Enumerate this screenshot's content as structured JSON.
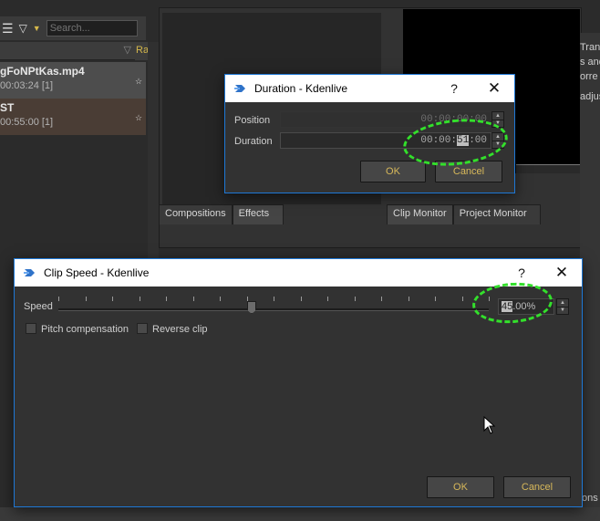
{
  "background": {
    "search_placeholder": "Search...",
    "column_header_r": "Ra",
    "clips": [
      {
        "name": "gFoNPtKas.mp4",
        "duration": "00:03:24 [1]"
      },
      {
        "name": "ST",
        "duration": "00:55:00 [1]"
      }
    ],
    "monitor_tabs_left": [
      "Compositions",
      "Effects"
    ],
    "monitor_tabs_right": [
      "Clip Monitor",
      "Project Monitor"
    ],
    "right_panel_lines": [
      "Trans",
      "s and",
      "orre",
      "adjus"
    ],
    "right_bottom_text": "ons"
  },
  "duration_dialog": {
    "title": "Duration - Kdenlive",
    "help": "?",
    "close": "✕",
    "position_label": "Position",
    "position_value": "00:00:00:00",
    "duration_label": "Duration",
    "duration_value_prefix": "00:00:",
    "duration_value_selected": "51",
    "duration_value_suffix": ":00",
    "ok_label": "OK",
    "cancel_label": "Cancel"
  },
  "speed_dialog": {
    "title": "Clip Speed - Kdenlive",
    "help": "?",
    "close": "✕",
    "speed_label": "Speed",
    "speed_selected": "45",
    "speed_suffix": ".00%",
    "slider_level_fraction": 0.45,
    "pitch_label": "Pitch compensation",
    "reverse_label": "Reverse clip",
    "ok_label": "OK",
    "cancel_label": "Cancel"
  },
  "colors": {
    "accent_button_text": "#d7b85a",
    "annotation": "#33e02b",
    "dialog_border": "#1e78d6"
  }
}
